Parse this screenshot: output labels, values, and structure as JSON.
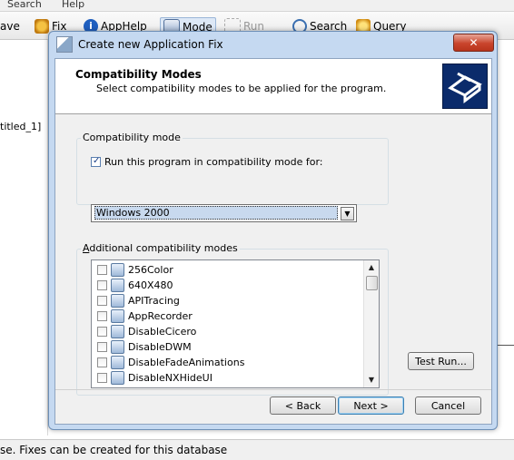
{
  "app": {
    "menu": {
      "search": "Search",
      "help": "Help"
    },
    "toolbar": {
      "save": "ave",
      "fix": "Fix",
      "apphelp": "AppHelp",
      "mode": "Mode",
      "run": "Run",
      "search": "Search",
      "query": "Query"
    },
    "tree_item": "titled_1]",
    "status": "se. Fixes can be created for this database"
  },
  "dialog": {
    "title": "Create new Application Fix",
    "close": "✕",
    "header": {
      "title": "Compatibility Modes",
      "subtitle": "Select compatibility modes to be applied for the program."
    },
    "compat_group": {
      "label": "Compatibility mode",
      "checkbox_label": "Run this program in compatibility mode for:",
      "checkbox_checked": true,
      "selected_mode": "Windows 2000"
    },
    "additional_group": {
      "label_prefix": "A",
      "label_rest": "dditional compatibility modes",
      "items": [
        "256Color",
        "640X480",
        "APITracing",
        "AppRecorder",
        "DisableCicero",
        "DisableDWM",
        "DisableFadeAnimations",
        "DisableNXHideUI"
      ]
    },
    "buttons": {
      "test_run": "Test Run...",
      "back": "< Back",
      "next": "Next >",
      "cancel": "Cancel"
    }
  }
}
